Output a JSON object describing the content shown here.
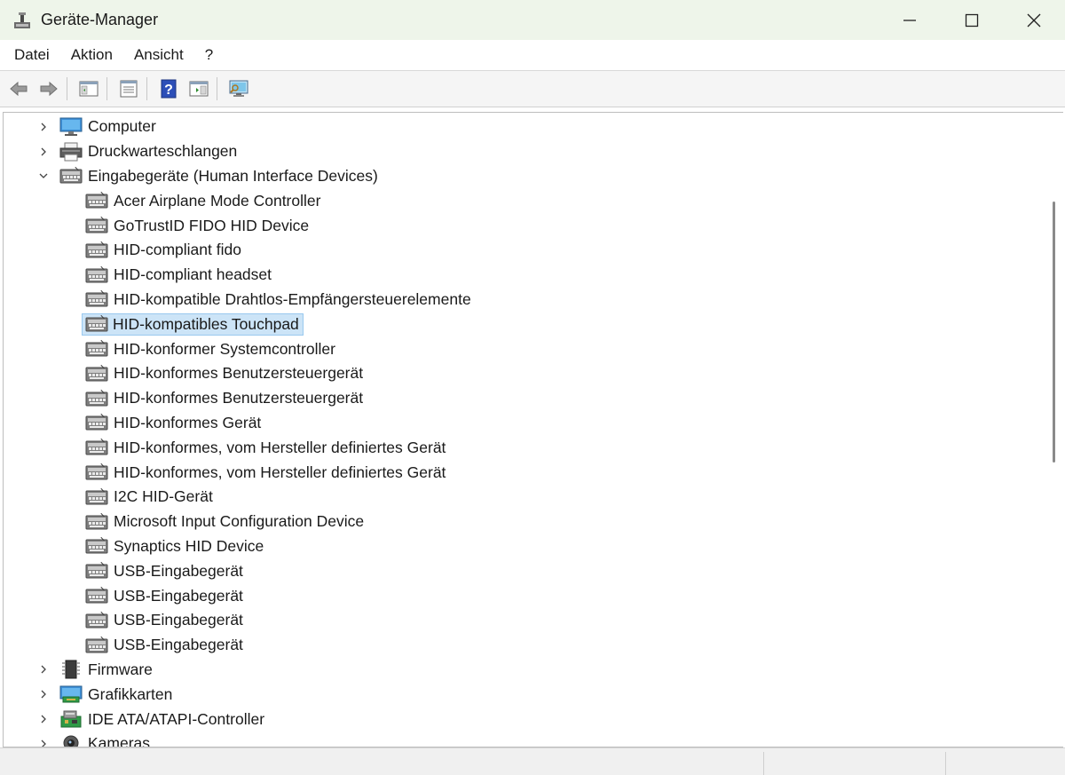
{
  "window": {
    "title": "Geräte-Manager",
    "minimize_label": "",
    "maximize_label": "",
    "close_label": ""
  },
  "menu": [
    {
      "label": "Datei"
    },
    {
      "label": "Aktion"
    },
    {
      "label": "Ansicht"
    },
    {
      "label": "?"
    }
  ],
  "toolbar": {
    "buttons": [
      {
        "name": "back",
        "icon": "arrow-left-icon"
      },
      {
        "name": "forward",
        "icon": "arrow-right-icon"
      },
      {
        "name": "show-hide-console-tree",
        "icon": "console-tree-icon"
      },
      {
        "name": "properties",
        "icon": "properties-icon"
      },
      {
        "name": "help",
        "icon": "help-icon"
      },
      {
        "name": "action-pane",
        "icon": "action-pane-icon"
      },
      {
        "name": "scan-hardware",
        "icon": "monitor-scan-icon"
      }
    ]
  },
  "tree": {
    "selected_index": 8,
    "nodes": [
      {
        "label": "Computer",
        "level": 0,
        "state": "collapsed",
        "icon": "computer-icon"
      },
      {
        "label": "Druckwarteschlangen",
        "level": 0,
        "state": "collapsed",
        "icon": "printer-icon"
      },
      {
        "label": "Eingabegeräte (Human Interface Devices)",
        "level": 0,
        "state": "expanded",
        "icon": "hid-icon"
      },
      {
        "label": "Acer Airplane Mode Controller",
        "level": 1,
        "icon": "hid-icon"
      },
      {
        "label": "GoTrustID FIDO HID Device",
        "level": 1,
        "icon": "hid-icon"
      },
      {
        "label": "HID-compliant fido",
        "level": 1,
        "icon": "hid-icon"
      },
      {
        "label": "HID-compliant headset",
        "level": 1,
        "icon": "hid-icon"
      },
      {
        "label": "HID-kompatible Drahtlos-Empfängersteuerelemente",
        "level": 1,
        "icon": "hid-icon"
      },
      {
        "label": "HID-kompatibles Touchpad",
        "level": 1,
        "icon": "hid-icon"
      },
      {
        "label": "HID-konformer Systemcontroller",
        "level": 1,
        "icon": "hid-icon"
      },
      {
        "label": "HID-konformes Benutzersteuergerät",
        "level": 1,
        "icon": "hid-icon"
      },
      {
        "label": "HID-konformes Benutzersteuergerät",
        "level": 1,
        "icon": "hid-icon"
      },
      {
        "label": "HID-konformes Gerät",
        "level": 1,
        "icon": "hid-icon"
      },
      {
        "label": "HID-konformes, vom Hersteller definiertes Gerät",
        "level": 1,
        "icon": "hid-icon"
      },
      {
        "label": "HID-konformes, vom Hersteller definiertes Gerät",
        "level": 1,
        "icon": "hid-icon"
      },
      {
        "label": "I2C HID-Gerät",
        "level": 1,
        "icon": "hid-icon"
      },
      {
        "label": "Microsoft Input Configuration Device",
        "level": 1,
        "icon": "hid-icon"
      },
      {
        "label": "Synaptics HID Device",
        "level": 1,
        "icon": "hid-icon"
      },
      {
        "label": "USB-Eingabegerät",
        "level": 1,
        "icon": "hid-icon"
      },
      {
        "label": "USB-Eingabegerät",
        "level": 1,
        "icon": "hid-icon"
      },
      {
        "label": "USB-Eingabegerät",
        "level": 1,
        "icon": "hid-icon"
      },
      {
        "label": "USB-Eingabegerät",
        "level": 1,
        "icon": "hid-icon"
      },
      {
        "label": "Firmware",
        "level": 0,
        "state": "collapsed",
        "icon": "firmware-chip-icon"
      },
      {
        "label": "Grafikkarten",
        "level": 0,
        "state": "collapsed",
        "icon": "display-adapter-icon"
      },
      {
        "label": "IDE ATA/ATAPI-Controller",
        "level": 0,
        "state": "collapsed",
        "icon": "ide-controller-icon"
      },
      {
        "label": "Kameras",
        "level": 0,
        "state": "collapsed",
        "icon": "camera-icon"
      }
    ]
  }
}
